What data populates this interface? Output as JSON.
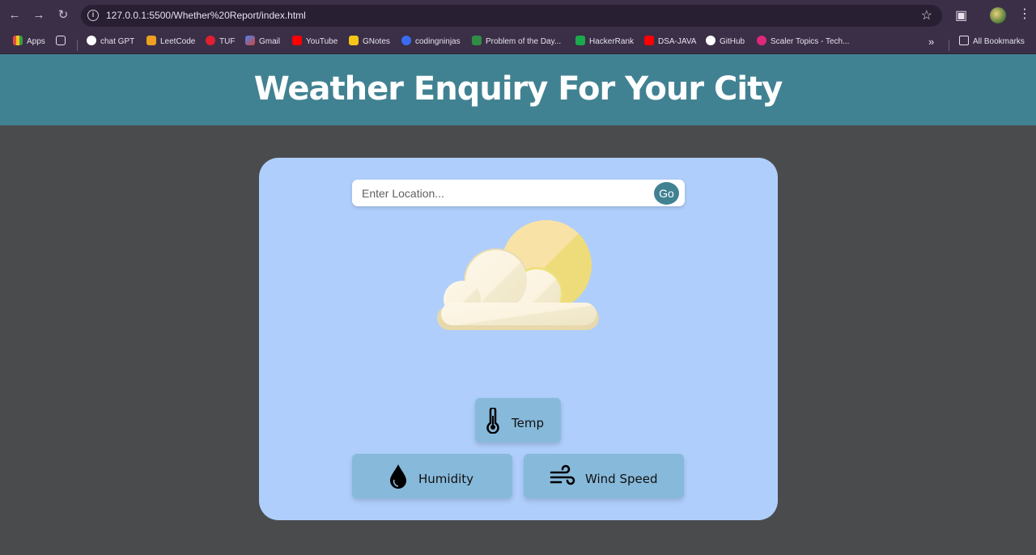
{
  "browser": {
    "url": "127.0.0.1:5500/Whether%20Report/index.html",
    "nav": {
      "back_icon": "arrow-left-icon",
      "forward_icon": "arrow-right-icon",
      "reload_icon": "reload-icon"
    },
    "bookmarks": [
      {
        "label": "Apps",
        "color": "#e05040"
      },
      {
        "label": "chat GPT",
        "color": "#ffffff"
      },
      {
        "label": "LeetCode",
        "color": "#f0a020"
      },
      {
        "label": "TUF",
        "color": "#e02030"
      },
      {
        "label": "Gmail",
        "color": "#d44638"
      },
      {
        "label": "YouTube",
        "color": "#ff0000"
      },
      {
        "label": "GNotes",
        "color": "#f5c518"
      },
      {
        "label": "codingninjas",
        "color": "#3b6cf0"
      },
      {
        "label": "Problem of the Day...",
        "color": "#2f8d46"
      },
      {
        "label": "HackerRank",
        "color": "#1ba94c"
      },
      {
        "label": "DSA-JAVA",
        "color": "#ff0000"
      },
      {
        "label": "GitHub",
        "color": "#ffffff"
      },
      {
        "label": "Scaler Topics - Tech...",
        "color": "#e0277a"
      }
    ],
    "all_bookmarks": "All Bookmarks",
    "overflow": "»"
  },
  "page": {
    "title": "Weather Enquiry For Your City",
    "search": {
      "placeholder": "Enter Location...",
      "value": "",
      "button": "Go"
    },
    "stats": {
      "temp": "Temp",
      "humidity": "Humidity",
      "wind": "Wind Speed"
    },
    "colors": {
      "header": "#418292",
      "card": "#afcefb",
      "stat": "#87b9da",
      "background": "#4a4b4d"
    }
  }
}
